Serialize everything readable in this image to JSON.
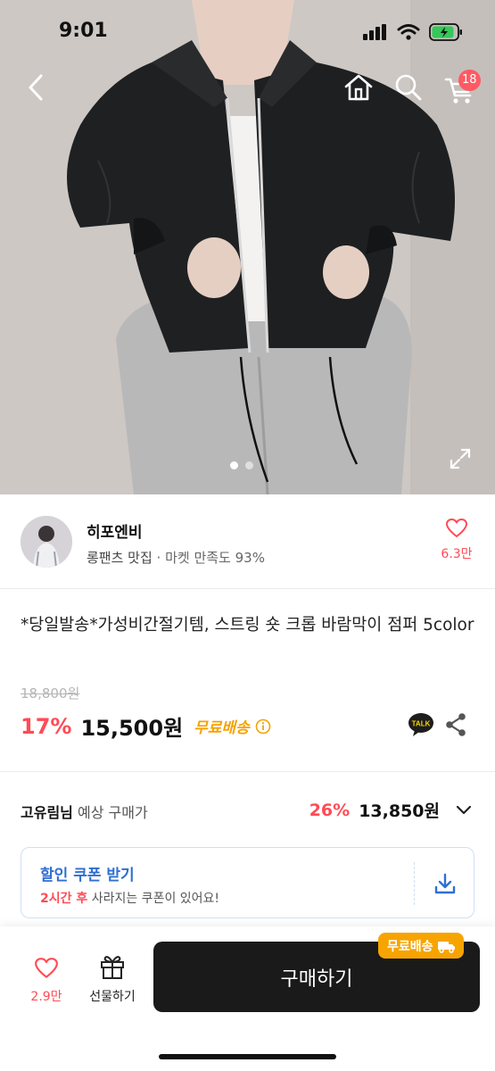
{
  "status_bar": {
    "time": "9:01"
  },
  "nav": {
    "cart_count": "18"
  },
  "gallery": {
    "page_count": 2,
    "active_index": 0
  },
  "seller": {
    "name": "히포엔비",
    "category": "롱팬츠 맛집",
    "separator": " · ",
    "satisfaction": "마켓 만족도 93%",
    "likes": "6.3만"
  },
  "product": {
    "title": "*당일발송*가성비간절기템, 스트링 숏 크롭 바람막이 점퍼 5color",
    "original_price": "18,800원",
    "discount": "17%",
    "price": "15,500원",
    "shipping": "무료배송"
  },
  "expected_price": {
    "user": "고유림님",
    "label": " 예상 구매가",
    "rate": "26%",
    "price": "13,850원"
  },
  "coupon": {
    "title": "할인 쿠폰 받기",
    "highlight": "2시간 후",
    "message": " 사라지는 쿠폰이 있어요!"
  },
  "bottom_bar": {
    "likes": "2.9만",
    "gift_label": "선물하기",
    "buy_label": "구매하기",
    "shipping_tag": "무료배송"
  },
  "colors": {
    "accent_red": "#ff4b56",
    "shipping_orange": "#f5a200",
    "coupon_blue": "#2f6fd1",
    "buy_button": "#1a1a1a"
  }
}
